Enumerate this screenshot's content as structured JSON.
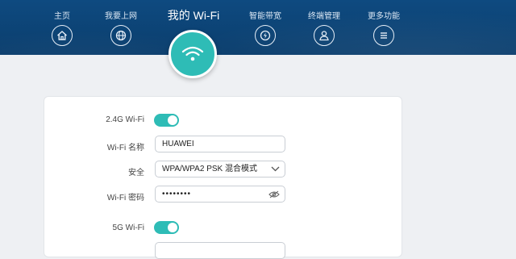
{
  "nav": {
    "items": [
      {
        "label": "主页",
        "icon": "home-icon"
      },
      {
        "label": "我要上网",
        "icon": "globe-icon"
      },
      {
        "label": "智能带宽",
        "icon": "bandwidth-icon"
      },
      {
        "label": "终端管理",
        "icon": "user-icon"
      },
      {
        "label": "更多功能",
        "icon": "menu-icon"
      }
    ],
    "active": {
      "label": "我的 Wi-Fi",
      "icon": "wifi-icon"
    }
  },
  "form": {
    "wifi24": {
      "label": "2.4G Wi-Fi",
      "enabled": true
    },
    "ssid": {
      "label": "Wi-Fi 名称",
      "value": "HUAWEI"
    },
    "security": {
      "label": "安全",
      "value": "WPA/WPA2 PSK 混合模式"
    },
    "password": {
      "label": "Wi-Fi 密码",
      "value": "••••••••"
    },
    "wifi5": {
      "label": "5G Wi-Fi",
      "enabled": true
    }
  },
  "colors": {
    "header": "#0e4a80",
    "accent": "#2ebcb6"
  }
}
